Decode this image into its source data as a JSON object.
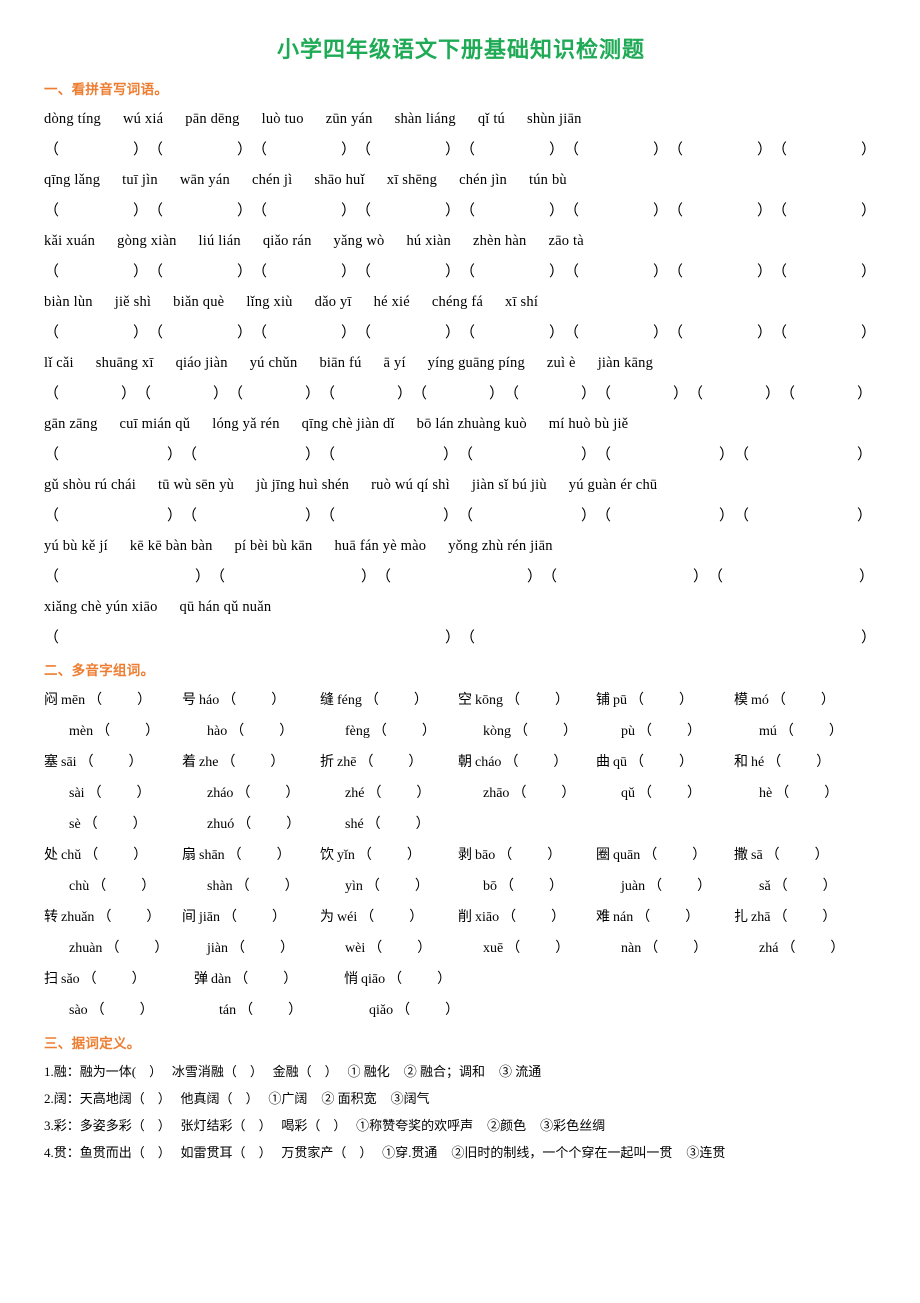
{
  "document": {
    "title": "小学四年级语文下册基础知识检测题",
    "title_color": "#1faa55",
    "heading_color": "#ED7D31"
  },
  "section1": {
    "heading": "一、看拼音写词语。",
    "rows": [
      {
        "items": [
          "dòng tíng",
          "wú xiá",
          "pān dēng",
          "luò tuo",
          "zūn yán",
          "shàn liáng",
          "qǐ tú",
          "shùn jiān"
        ],
        "blanks": 8
      },
      {
        "items": [
          "qīng lǎng",
          "tuī jìn",
          "wān yán",
          "chén jì",
          "shāo huǐ",
          "xī shēng",
          "chén jìn",
          "tún bù"
        ],
        "blanks": 8
      },
      {
        "items": [
          "kǎi xuán",
          "gòng xiàn",
          "liú lián",
          "qiǎo rán",
          "yǎng wò",
          "hú xiàn",
          "zhèn hàn",
          "zāo tà"
        ],
        "blanks": 8
      },
      {
        "items": [
          "biàn lùn",
          "jiě shì",
          "biǎn què",
          "lǐng xiù",
          "dǎo yī",
          "hé xié",
          "chéng fá",
          "xī shí"
        ],
        "blanks": 8
      },
      {
        "items": [
          "lǐ cǎi",
          "shuāng xī",
          "qiáo jiàn",
          "yú chǔn",
          "biān fú",
          "ā yí",
          "yíng guāng píng",
          "zuì è",
          "jiàn kāng"
        ],
        "blanks": 9
      },
      {
        "items": [
          "gān zāng",
          "cuī mián qǔ",
          "lóng yǎ rén",
          "qīng chè jiàn dǐ",
          "bō lán zhuàng kuò",
          "mí huò bù jiě"
        ],
        "blanks": 6
      },
      {
        "items": [
          "gǔ shòu rú chái",
          "tū wù sēn yù",
          "jù jīng huì shén",
          "ruò wú qí shì",
          "jiàn sǐ bú jiù",
          "yú guàn ér chū"
        ],
        "blanks": 6
      },
      {
        "items": [
          "yú bù kě jí",
          "kē kē bàn bàn",
          "pí bèi bù kān",
          "huā fán yè mào",
          "yǒng zhù rén jiān"
        ],
        "blanks": 5
      },
      {
        "items": [
          "xiǎng chè yún xiāo",
          "qū hán qǔ nuǎn"
        ],
        "blanks": 2
      }
    ]
  },
  "section2": {
    "heading": "二、多音字组词。",
    "groups": [
      {
        "columns": [
          {
            "char": "闷",
            "readings": [
              "mēn",
              "mèn"
            ]
          },
          {
            "char": "号",
            "readings": [
              "háo",
              "hào"
            ]
          },
          {
            "char": "缝",
            "readings": [
              "féng",
              "fèng"
            ]
          },
          {
            "char": "空",
            "readings": [
              "kōng",
              "kòng"
            ]
          },
          {
            "char": "铺",
            "readings": [
              "pū",
              "pù"
            ]
          },
          {
            "char": "模",
            "readings": [
              "mó",
              "mú"
            ]
          }
        ]
      },
      {
        "columns": [
          {
            "char": "塞",
            "readings": [
              "sāi",
              "sài",
              "sè"
            ]
          },
          {
            "char": "着",
            "readings": [
              "zhe",
              "zháo",
              "zhuó"
            ]
          },
          {
            "char": "折",
            "readings": [
              "zhē",
              "zhé",
              "shé"
            ]
          },
          {
            "char": "朝",
            "readings": [
              "cháo",
              "zhāo"
            ]
          },
          {
            "char": "曲",
            "readings": [
              "qū",
              "qǔ"
            ]
          },
          {
            "char": "和",
            "readings": [
              "hé",
              "hè"
            ]
          }
        ]
      },
      {
        "columns": [
          {
            "char": "处",
            "readings": [
              "chǔ",
              "chù"
            ]
          },
          {
            "char": "扇",
            "readings": [
              "shān",
              "shàn"
            ]
          },
          {
            "char": "饮",
            "readings": [
              "yǐn",
              "yìn"
            ]
          },
          {
            "char": "剥",
            "readings": [
              "bāo",
              "bō"
            ]
          },
          {
            "char": "圈",
            "readings": [
              "quān",
              "juàn"
            ]
          },
          {
            "char": "撒",
            "readings": [
              "sā",
              "sǎ"
            ]
          }
        ]
      },
      {
        "columns": [
          {
            "char": "转",
            "readings": [
              "zhuǎn",
              "zhuàn"
            ]
          },
          {
            "char": "间",
            "readings": [
              "jiān",
              "jiàn"
            ]
          },
          {
            "char": "为",
            "readings": [
              "wéi",
              "wèi"
            ]
          },
          {
            "char": "削",
            "readings": [
              "xiāo",
              "xuē"
            ]
          },
          {
            "char": "难",
            "readings": [
              "nán",
              "nàn"
            ]
          },
          {
            "char": "扎",
            "readings": [
              "zhā",
              "zhá"
            ]
          }
        ]
      },
      {
        "columns": [
          {
            "char": "扫",
            "readings": [
              "sǎo",
              "sào"
            ]
          },
          {
            "char": "弹",
            "readings": [
              "dàn",
              "tán"
            ]
          },
          {
            "char": "悄",
            "readings": [
              "qiāo",
              "qiǎo"
            ]
          }
        ]
      }
    ]
  },
  "section3": {
    "heading": "三、据词定义。",
    "items": [
      {
        "number": "1.",
        "char": "融：",
        "usages": [
          "融为一体(",
          "冰雪消融（",
          "金融（"
        ],
        "senses": [
          "① 融化",
          "②  融合；调和",
          "③ 流通"
        ]
      },
      {
        "number": "2.",
        "char": "阔：",
        "usages": [
          "天高地阔（",
          "他真阔（"
        ],
        "senses": [
          "①广阔",
          "② 面积宽",
          "③阔气"
        ]
      },
      {
        "number": "3.",
        "char": "彩：",
        "usages": [
          "多姿多彩（",
          "张灯结彩（",
          "喝彩（"
        ],
        "senses": [
          "①称赞夸奖的欢呼声",
          "②颜色",
          "③彩色丝绸"
        ]
      },
      {
        "number": "4.",
        "char": "贯：",
        "usages": [
          "鱼贯而出（",
          "如雷贯耳（",
          "万贯家产（"
        ],
        "senses": [
          "①穿.贯通",
          "②旧时的制线，一个个穿在一起叫一贯",
          "③连贯"
        ]
      }
    ]
  }
}
